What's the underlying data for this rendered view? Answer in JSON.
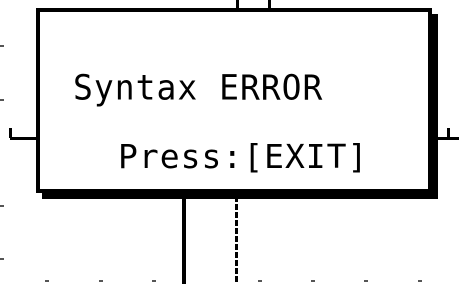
{
  "dialog": {
    "message": "Syntax ERROR",
    "hint": "Press:[EXIT]"
  }
}
